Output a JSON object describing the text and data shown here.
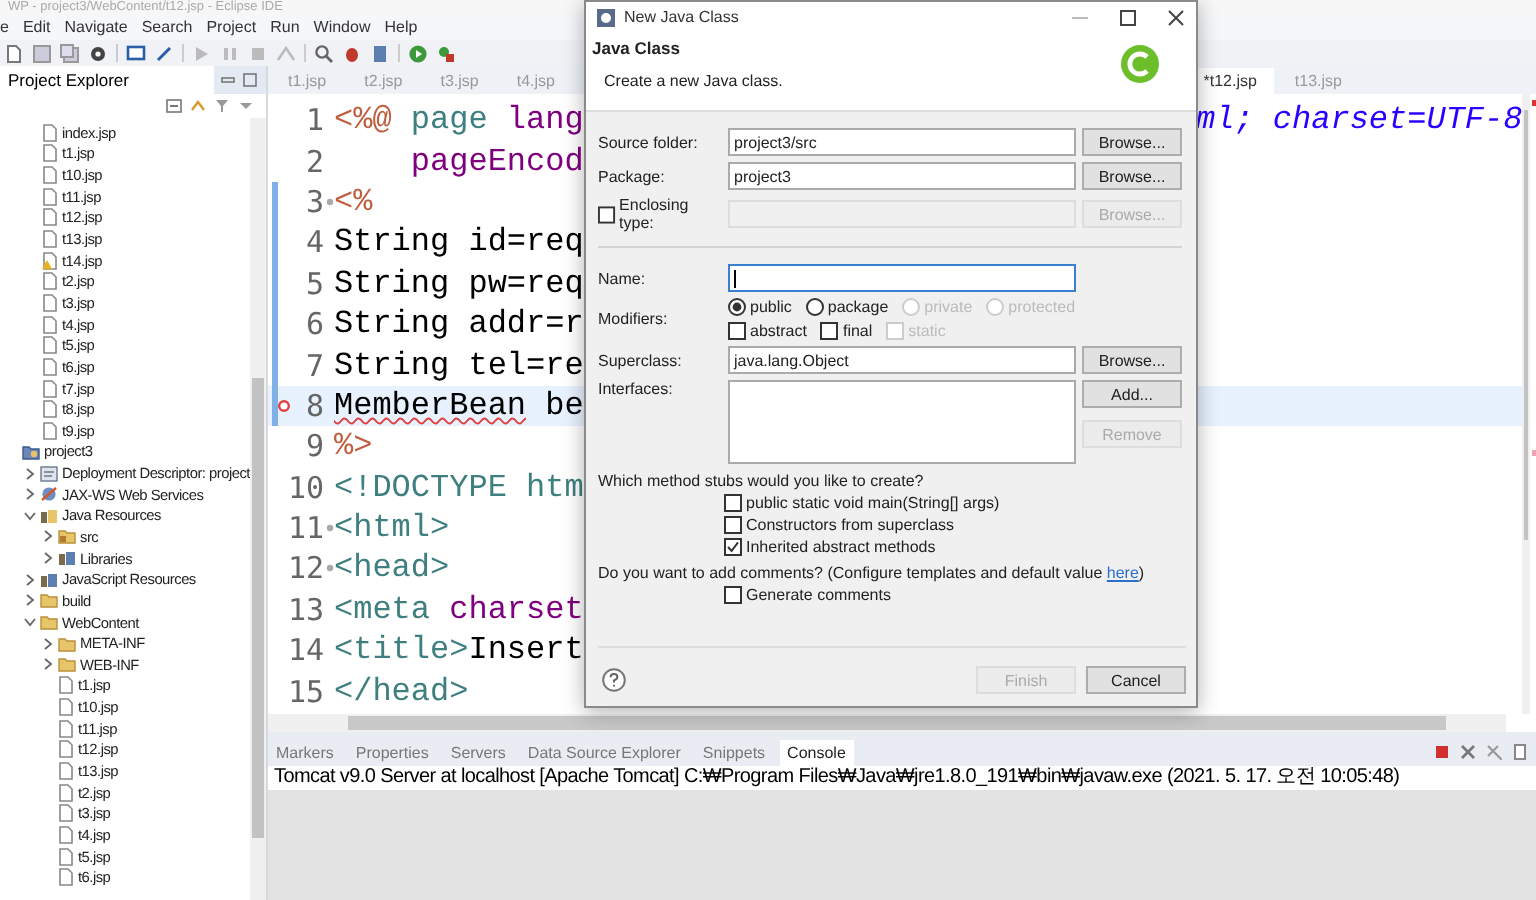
{
  "window": {
    "title": "WP - project3/WebContent/t12.jsp - Eclipse IDE"
  },
  "menu": [
    "e",
    "Edit",
    "Navigate",
    "Search",
    "Project",
    "Run",
    "Window",
    "Help"
  ],
  "explorer": {
    "title": "Project Explorer",
    "scrolled_files": [
      {
        "label": "index.jsp",
        "kind": "file"
      },
      {
        "label": "t1.jsp",
        "kind": "file"
      },
      {
        "label": "t10.jsp",
        "kind": "file"
      },
      {
        "label": "t11.jsp",
        "kind": "file"
      },
      {
        "label": "t12.jsp",
        "kind": "file"
      },
      {
        "label": "t13.jsp",
        "kind": "file"
      },
      {
        "label": "t14.jsp",
        "kind": "file-warning"
      },
      {
        "label": "t2.jsp",
        "kind": "file"
      },
      {
        "label": "t3.jsp",
        "kind": "file"
      },
      {
        "label": "t4.jsp",
        "kind": "file"
      },
      {
        "label": "t5.jsp",
        "kind": "file"
      },
      {
        "label": "t6.jsp",
        "kind": "file"
      },
      {
        "label": "t7.jsp",
        "kind": "file"
      },
      {
        "label": "t8.jsp",
        "kind": "file"
      },
      {
        "label": "t9.jsp",
        "kind": "file"
      }
    ],
    "tree": [
      {
        "label": "project3",
        "kind": "project",
        "children": [
          {
            "label": "Deployment Descriptor: project",
            "kind": "descriptor",
            "expanded": false
          },
          {
            "label": "JAX-WS Web Services",
            "kind": "services",
            "expanded": false
          },
          {
            "label": "Java Resources",
            "kind": "resources",
            "expanded": true,
            "children": [
              {
                "label": "src",
                "kind": "package-folder",
                "expanded": false
              },
              {
                "label": "Libraries",
                "kind": "library",
                "expanded": false
              }
            ]
          },
          {
            "label": "JavaScript Resources",
            "kind": "library",
            "expanded": false
          },
          {
            "label": "build",
            "kind": "folder",
            "expanded": false
          },
          {
            "label": "WebContent",
            "kind": "folder",
            "expanded": true,
            "children": [
              {
                "label": "META-INF",
                "kind": "folder",
                "expanded": false
              },
              {
                "label": "WEB-INF",
                "kind": "folder",
                "expanded": false
              },
              {
                "label": "t1.jsp",
                "kind": "file"
              },
              {
                "label": "t10.jsp",
                "kind": "file"
              },
              {
                "label": "t11.jsp",
                "kind": "file"
              },
              {
                "label": "t12.jsp",
                "kind": "file"
              },
              {
                "label": "t13.jsp",
                "kind": "file"
              },
              {
                "label": "t2.jsp",
                "kind": "file"
              },
              {
                "label": "t3.jsp",
                "kind": "file"
              },
              {
                "label": "t4.jsp",
                "kind": "file"
              },
              {
                "label": "t5.jsp",
                "kind": "file"
              },
              {
                "label": "t6.jsp",
                "kind": "file"
              }
            ]
          }
        ]
      }
    ]
  },
  "editor": {
    "tabs_left": [
      {
        "label": "t1.jsp",
        "selected": false
      },
      {
        "label": "t2.jsp",
        "selected": false
      },
      {
        "label": "t3.jsp",
        "selected": false
      },
      {
        "label": "t4.jsp",
        "selected": false
      }
    ],
    "tabs_right": [
      {
        "label": "*t12.jsp",
        "selected": true
      },
      {
        "label": "t13.jsp",
        "selected": false
      }
    ],
    "lines": [
      {
        "number": "1",
        "segments": [
          {
            "text": "<%@",
            "kind": "delim"
          },
          {
            "text": " page",
            "kind": "tag"
          },
          {
            "text": " lang",
            "kind": "attr"
          }
        ],
        "tail": "ml; charset=UTF-8",
        "current": false,
        "changed": false,
        "error": false,
        "fold": false
      },
      {
        "number": "2",
        "segments": [
          {
            "text": "    pageEncod",
            "kind": "attr"
          }
        ],
        "current": false,
        "changed": false,
        "error": false,
        "fold": false
      },
      {
        "number": "3",
        "segments": [
          {
            "text": "<%",
            "kind": "delim"
          }
        ],
        "current": false,
        "changed": true,
        "error": false,
        "fold": true
      },
      {
        "number": "4",
        "segments": [
          {
            "text": "String id=req",
            "kind": "text"
          }
        ],
        "current": false,
        "changed": true,
        "error": false,
        "fold": false
      },
      {
        "number": "5",
        "segments": [
          {
            "text": "String pw=req",
            "kind": "text"
          }
        ],
        "current": false,
        "changed": true,
        "error": false,
        "fold": false
      },
      {
        "number": "6",
        "segments": [
          {
            "text": "String addr=r",
            "kind": "text"
          }
        ],
        "current": false,
        "changed": true,
        "error": false,
        "fold": false
      },
      {
        "number": "7",
        "segments": [
          {
            "text": "String tel=re",
            "kind": "text"
          }
        ],
        "current": false,
        "changed": true,
        "error": false,
        "fold": false
      },
      {
        "number": "8",
        "segments": [
          {
            "text": "MemberBean",
            "kind": "unresolved"
          },
          {
            "text": " be",
            "kind": "text"
          }
        ],
        "current": true,
        "changed": true,
        "error": true,
        "fold": false
      },
      {
        "number": "9",
        "segments": [
          {
            "text": "%>",
            "kind": "delim"
          }
        ],
        "current": false,
        "changed": false,
        "error": false,
        "fold": false
      },
      {
        "number": "10",
        "segments": [
          {
            "text": "<!DOCTYPE htm",
            "kind": "tag"
          }
        ],
        "current": false,
        "changed": false,
        "error": false,
        "fold": false
      },
      {
        "number": "11",
        "segments": [
          {
            "text": "<html>",
            "kind": "tag"
          }
        ],
        "current": false,
        "changed": false,
        "error": false,
        "fold": true
      },
      {
        "number": "12",
        "segments": [
          {
            "text": "<head>",
            "kind": "tag"
          }
        ],
        "current": false,
        "changed": false,
        "error": false,
        "fold": true
      },
      {
        "number": "13",
        "segments": [
          {
            "text": "<meta",
            "kind": "tag"
          },
          {
            "text": " charset",
            "kind": "attr"
          }
        ],
        "current": false,
        "changed": false,
        "error": false,
        "fold": false
      },
      {
        "number": "14",
        "segments": [
          {
            "text": "<title>",
            "kind": "tag"
          },
          {
            "text": "Insert",
            "kind": "text"
          }
        ],
        "current": false,
        "changed": false,
        "error": false,
        "fold": false
      },
      {
        "number": "15",
        "segments": [
          {
            "text": "</head>",
            "kind": "tag"
          }
        ],
        "current": false,
        "changed": false,
        "error": false,
        "fold": false
      }
    ]
  },
  "bottom_panel": {
    "tabs": [
      {
        "label": "Markers",
        "selected": false
      },
      {
        "label": "Properties",
        "selected": false
      },
      {
        "label": "Servers",
        "selected": false
      },
      {
        "label": "Data Source Explorer",
        "selected": false
      },
      {
        "label": "Snippets",
        "selected": false
      },
      {
        "label": "Console",
        "selected": true
      }
    ],
    "console_line": "Tomcat v9.0 Server at localhost [Apache Tomcat] C:₩Program Files₩Java₩jre1.8.0_191₩bin₩javaw.exe (2021. 5. 17. 오전 10:05:48)"
  },
  "dialog": {
    "title": "New Java Class",
    "heading": "Java Class",
    "description": "Create a new Java class.",
    "rows": [
      {
        "kind": "text",
        "label": "Source folder:",
        "value": "project3/src",
        "button": {
          "label": "Browse...",
          "disabled": false
        }
      },
      {
        "kind": "text",
        "label": "Package:",
        "value": "project3",
        "button": {
          "label": "Browse...",
          "disabled": false
        }
      },
      {
        "kind": "check-text",
        "label": "Enclosing type:",
        "checked": false,
        "button": {
          "label": "Browse...",
          "disabled": true
        }
      },
      {
        "kind": "separator"
      },
      {
        "kind": "text",
        "label": "Name:",
        "focused": true
      },
      {
        "kind": "modifiers",
        "label": "Modifiers:",
        "radios": [
          {
            "label": "public",
            "selected": true,
            "disabled": false
          },
          {
            "label": "package",
            "selected": false,
            "disabled": false
          },
          {
            "label": "private",
            "selected": false,
            "disabled": true
          },
          {
            "label": "protected",
            "selected": false,
            "disabled": true
          }
        ],
        "checks": [
          {
            "label": "abstract",
            "checked": false,
            "disabled": false
          },
          {
            "label": "final",
            "checked": false,
            "disabled": false
          },
          {
            "label": "static",
            "checked": false,
            "disabled": true
          }
        ]
      },
      {
        "kind": "text",
        "label": "Superclass:",
        "value": "java.lang.Object",
        "button": {
          "label": "Browse...",
          "disabled": false
        }
      },
      {
        "kind": "list",
        "label": "Interfaces:",
        "buttons": [
          {
            "label": "Add...",
            "disabled": false
          },
          {
            "label": "Remove",
            "disabled": true
          }
        ]
      }
    ],
    "stubs": {
      "question": "Which method stubs would you like to create?",
      "options": [
        {
          "label": "public static void main(String[] args)",
          "checked": false
        },
        {
          "label": "Constructors from superclass",
          "checked": false
        },
        {
          "label": "Inherited abstract methods",
          "checked": true
        }
      ]
    },
    "comments": {
      "before": "Do you want to add comments? (Configure templates and default value",
      "link": "here",
      "after": ")",
      "options": [
        {
          "label": "Generate comments",
          "checked": false
        }
      ]
    },
    "buttons": [
      {
        "label": "Finish",
        "disabled": true
      },
      {
        "label": "Cancel",
        "disabled": false
      }
    ]
  }
}
